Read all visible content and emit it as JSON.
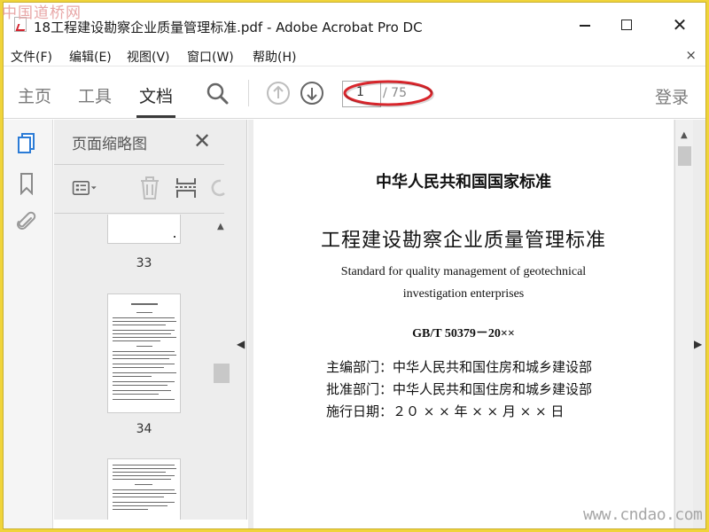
{
  "watermarks": {
    "top": "中国道桥网",
    "bottom": "www.cndao.com"
  },
  "window": {
    "title": "18工程建设勘察企业质量管理标准.pdf - Adobe Acrobat Pro DC"
  },
  "menu": {
    "items": [
      "文件(F)",
      "编辑(E)",
      "视图(V)",
      "窗口(W)",
      "帮助(H)"
    ],
    "close": "×"
  },
  "toolbar": {
    "tabs": [
      "主页",
      "工具",
      "文档"
    ],
    "active_tab": "文档",
    "page_current": "1",
    "page_total": "/ 75",
    "login": "登录"
  },
  "thumbnails_panel": {
    "title": "页面缩略图",
    "close": "✕",
    "pages": [
      {
        "number": "33"
      },
      {
        "number": "34"
      }
    ]
  },
  "document": {
    "line1": "中华人民共和国国家标准",
    "line2": "工程建设勘察企业质量管理标准",
    "line3": "Standard for quality management of geotechnical",
    "line4": "investigation enterprises",
    "line5": "GB/T 50379－20××",
    "info": [
      "主编部门：中华人民共和国住房和城乡建设部",
      "批准部门：中华人民共和国住房和城乡建设部",
      "施行日期：２０ × × 年 × × 月 × × 日"
    ]
  },
  "colors": {
    "frame": "#f0d43a",
    "accent_blue": "#2b7bd6",
    "annotation_red": "#d9262c"
  }
}
